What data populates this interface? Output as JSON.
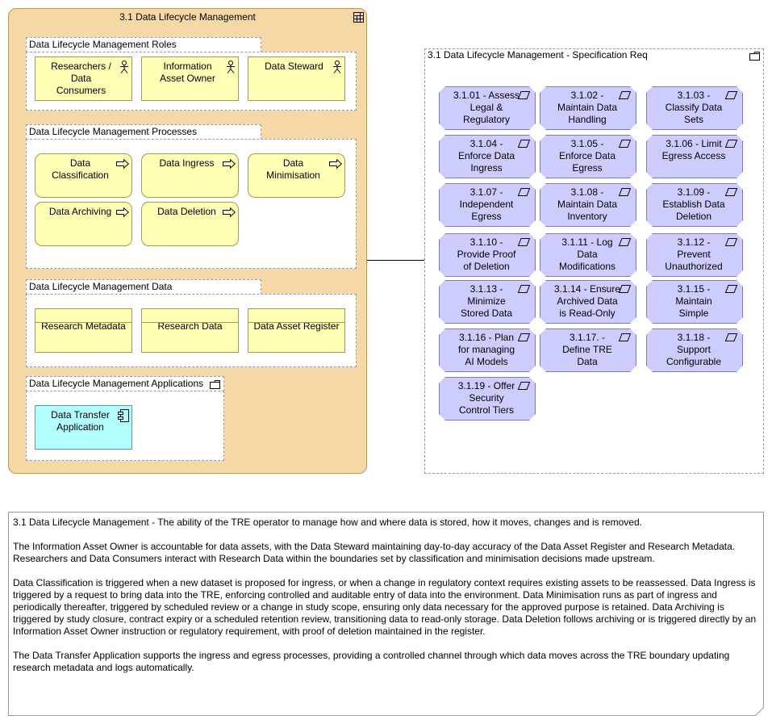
{
  "main_group": {
    "title": "3.1 Data Lifecycle Management",
    "roles": {
      "title": "Data Lifecycle Management Roles",
      "items": [
        "Researchers /\nData\nConsumers",
        "Information\nAsset Owner",
        "Data Steward"
      ]
    },
    "processes": {
      "title": "Data Lifecycle Management Processes",
      "items": [
        "Data\nClassification",
        "Data Ingress",
        "Data\nMinimisation",
        "Data Archiving",
        "Data Deletion"
      ]
    },
    "data": {
      "title": "Data Lifecycle Management Data",
      "items": [
        "Research Metadata",
        "Research Data",
        "Data Asset Register"
      ]
    },
    "applications": {
      "title": "Data Lifecycle Management Applications",
      "items": [
        "Data Transfer\nApplication"
      ]
    }
  },
  "spec_group": {
    "title": "3.1 Data Lifecycle Management - Specification Req",
    "requirements": [
      "3.1.01 - Assess\nLegal &\nRegulatory",
      "3.1.02 -\nMaintain Data\nHandling",
      "3.1.03 -\nClassify Data\nSets",
      "3.1.04 -\nEnforce Data\nIngress",
      "3.1.05 -\nEnforce Data\nEgress",
      "3.1.06 - Limit\nEgress Access",
      "3.1.07 -\nIndependent\nEgress",
      "3.1.08 -\nMaintain Data\nInventory",
      "3.1.09 -\nEstablish Data\nDeletion",
      "3.1.10 -\nProvide Proof\nof Deletion",
      "3.1.11 - Log\nData\nModifications",
      "3.1.12 -\nPrevent\nUnauthorized",
      "3.1.13 -\nMinimize\nStored Data",
      "3.1.14 - Ensure\nArchived Data\nis Read-Only",
      "3.1.15 -\nMaintain\nSimple",
      "3.1.16 - Plan\nfor managing\nAI Models",
      "3.1.17. -\nDefine TRE\nData",
      "3.1.18 -\nSupport\nConfigurable",
      "3.1.19 - Offer\nSecurity\nControl Tiers"
    ]
  },
  "note": {
    "paragraphs": [
      "3.1 Data Lifecycle Management - The ability of the TRE operator to manage how and where data is stored, how it moves, changes and is removed.",
      "The Information Asset Owner is accountable for data assets, with the Data Steward maintaining day-to-day accuracy of the Data Asset Register and Research Metadata. Researchers and Data Consumers interact with Research Data within the boundaries set by classification and minimisation decisions made upstream.",
      "Data Classification is triggered when a new dataset is proposed for ingress, or when a change in regulatory context requires existing assets to be reassessed. Data Ingress is triggered by a request to bring data into the TRE, enforcing controlled and auditable entry of data into the environment. Data Minimisation runs as part of ingress and periodically thereafter, triggered by scheduled review or a change in study scope, ensuring only data necessary for the approved purpose is retained. Data Archiving is triggered by study closure, contract expiry or a scheduled retention review, transitioning data to read-only storage. Data Deletion follows archiving or is triggered directly by an Information Asset Owner instruction or regulatory requirement, with proof of deletion maintained in the register.",
      "The Data Transfer Application supports the ingress and egress processes, providing a controlled channel through which data moves across the TRE boundary updating research metadata and logs automatically."
    ]
  }
}
